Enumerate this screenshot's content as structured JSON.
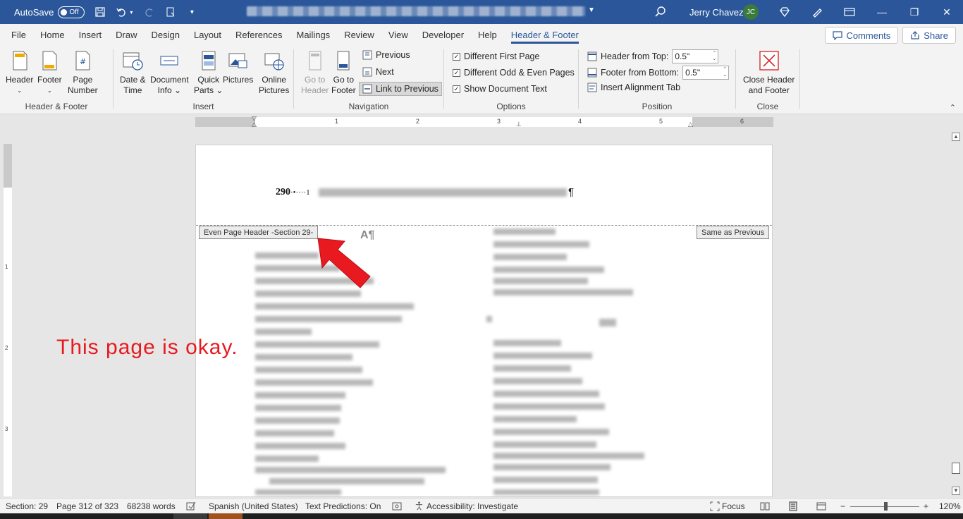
{
  "titlebar": {
    "autosave_label": "AutoSave",
    "autosave_state": "Off",
    "user_name": "Jerry Chavez",
    "user_initials": "JC"
  },
  "menu": {
    "tabs": [
      "File",
      "Home",
      "Insert",
      "Draw",
      "Design",
      "Layout",
      "References",
      "Mailings",
      "Review",
      "View",
      "Developer",
      "Help",
      "Header & Footer"
    ],
    "active_tab": "Header & Footer",
    "comments_label": "Comments",
    "share_label": "Share"
  },
  "ribbon": {
    "groups": {
      "header_footer": "Header & Footer",
      "insert": "Insert",
      "navigation": "Navigation",
      "options": "Options",
      "position": "Position",
      "close": "Close"
    },
    "header_btn": "Header",
    "footer_btn": "Footer",
    "page_number_btn_1": "Page",
    "page_number_btn_2": "Number",
    "date_time_1": "Date &",
    "date_time_2": "Time",
    "doc_info_1": "Document",
    "doc_info_2": "Info",
    "quick_parts_1": "Quick",
    "quick_parts_2": "Parts",
    "pictures": "Pictures",
    "online_pictures_1": "Online",
    "online_pictures_2": "Pictures",
    "go_header_1": "Go to",
    "go_header_2": "Header",
    "go_footer_1": "Go to",
    "go_footer_2": "Footer",
    "previous": "Previous",
    "next": "Next",
    "link_previous": "Link to Previous",
    "opt_first_page": "Different First Page",
    "opt_odd_even": "Different Odd & Even Pages",
    "opt_show_doc": "Show Document Text",
    "header_from_top": "Header from Top:",
    "header_from_top_value": "0.5\"",
    "footer_from_bottom": "Footer from Bottom:",
    "footer_from_bottom_value": "0.5\"",
    "insert_alignment_tab": "Insert Alignment Tab",
    "close_1": "Close Header",
    "close_2": "and Footer"
  },
  "ruler": {
    "numbers": [
      "1",
      "2",
      "3",
      "4",
      "5",
      "6"
    ],
    "vnumbers": [
      "1",
      "2",
      "3"
    ]
  },
  "document": {
    "header_number": "290",
    "header_dots": "·•····1",
    "pilcrow": "¶",
    "even_page_header_tag": "Even Page Header -Section 29-",
    "same_as_previous_tag": "Same as Previous",
    "a_mark": "A¶",
    "annotation": "This page is okay."
  },
  "status": {
    "section": "Section: 29",
    "page": "Page 312 of 323",
    "words": "68238 words",
    "language": "Spanish (United States)",
    "text_predictions": "Text Predictions: On",
    "accessibility": "Accessibility: Investigate",
    "focus": "Focus",
    "zoom": "120%"
  },
  "colors": {
    "titlebar": "#2b579a",
    "annotation_red": "#e8191f"
  }
}
